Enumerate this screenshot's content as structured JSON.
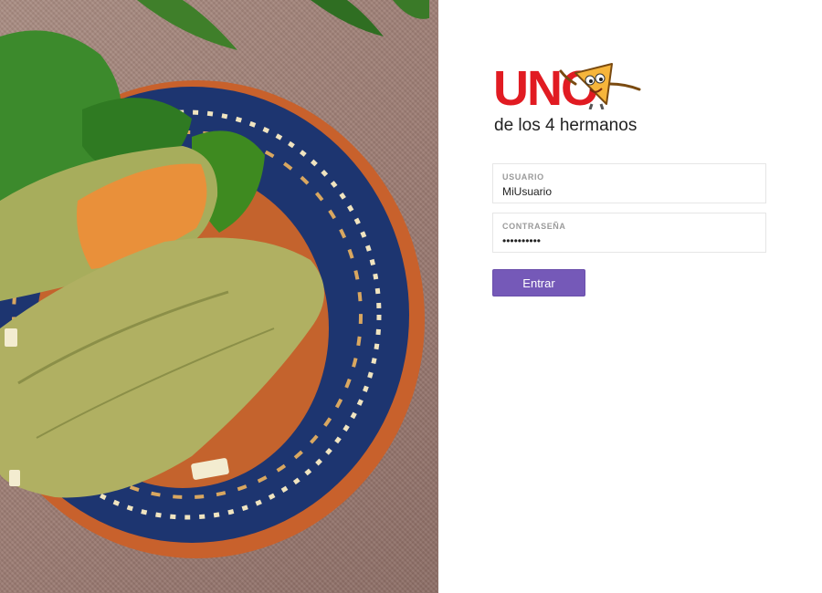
{
  "logo": {
    "brand": "UNO",
    "tagline": "de los 4 hermanos",
    "mascot_icon": "pizza-slice-mascot-icon"
  },
  "hero": {
    "image": "tamales-on-plate-photo"
  },
  "form": {
    "username": {
      "label": "USUARIO",
      "value": "MiUsuario"
    },
    "password": {
      "label": "CONTRASEÑA",
      "value": "••••••••••"
    },
    "submit_label": "Entrar"
  },
  "colors": {
    "brand_red": "#e11b22",
    "button_purple": "#7559b8",
    "plate_rim": "#c8612c",
    "plate_blue": "#1d3570",
    "tamal_green": "#a7ad5c"
  }
}
